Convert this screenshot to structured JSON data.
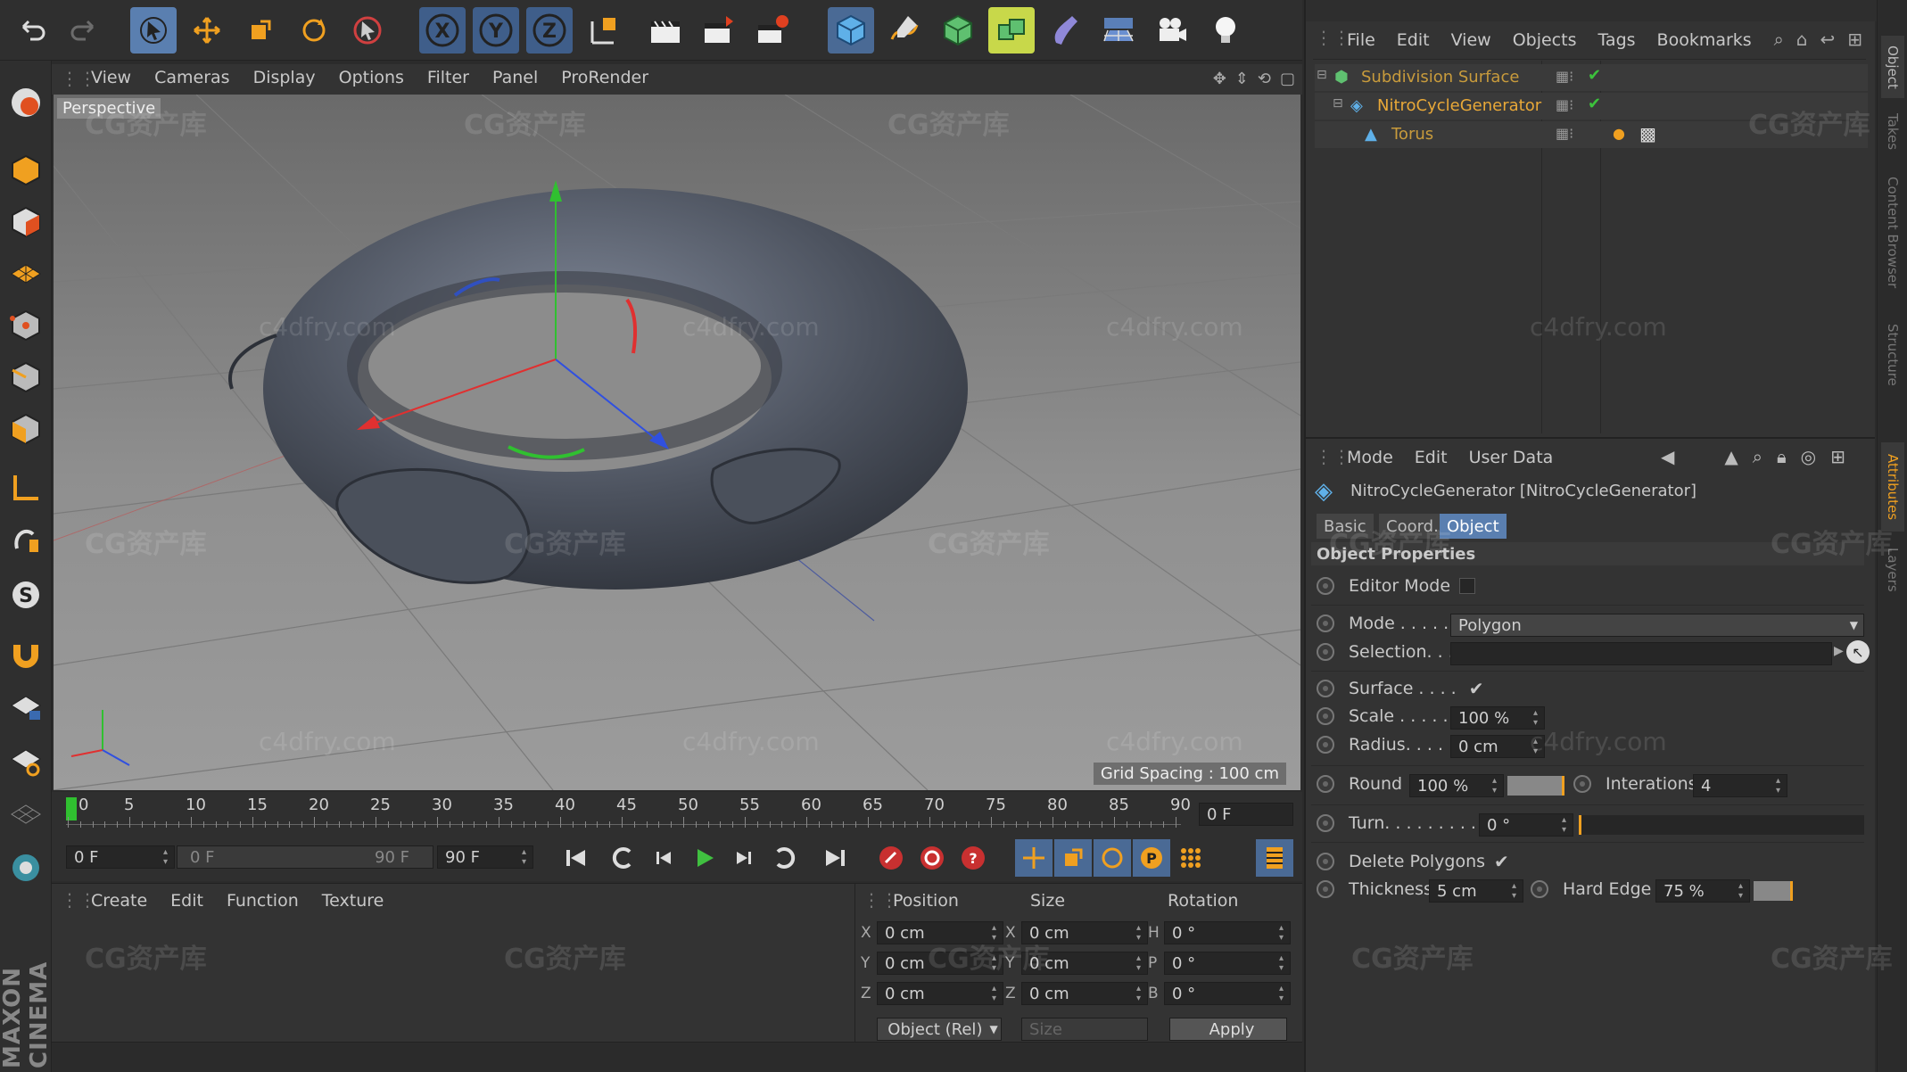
{
  "viewport": {
    "menu": [
      "View",
      "Cameras",
      "Display",
      "Options",
      "Filter",
      "Panel",
      "ProRender"
    ],
    "label": "Perspective",
    "grid_spacing": "Grid Spacing : 100 cm"
  },
  "objects_manager": {
    "menu": [
      "File",
      "Edit",
      "View",
      "Objects",
      "Tags",
      "Bookmarks"
    ],
    "tree": [
      {
        "name": "Subdivision Surface",
        "color": "#c89b3c"
      },
      {
        "name": "NitroCycleGenerator",
        "color": "#e8a838"
      },
      {
        "name": "Torus",
        "color": "#c89b3c"
      }
    ]
  },
  "side_tabs": [
    "Object",
    "Takes",
    "Content Browser",
    "Structure",
    "Attributes",
    "Layers"
  ],
  "attributes": {
    "menu": [
      "Mode",
      "Edit",
      "User Data"
    ],
    "title": "NitroCycleGenerator [NitroCycleGenerator]",
    "tabs": [
      "Basic",
      "Coord.",
      "Object"
    ],
    "section": "Object Properties",
    "editor_mode_label": "Editor Mode",
    "mode_label": "Mode . . . . .",
    "mode_value": "Polygon",
    "selection_label": "Selection. . .",
    "surface_label": "Surface . . . .",
    "scale_label": "Scale . . . . . .",
    "scale_value": "100 %",
    "radius_label": "Radius. . . . .",
    "radius_value": "0 cm",
    "round_label": "Round",
    "round_value": "100 %",
    "iterations_label": "Interations",
    "iterations_value": "4",
    "turn_label": "Turn. . . . . . . . . .",
    "turn_value": "0 °",
    "delete_polygons_label": "Delete Polygons",
    "thickness_label": "Thickness",
    "thickness_value": "5 cm",
    "hard_edge_label": "Hard Edge",
    "hard_edge_value": "75 %"
  },
  "timeline": {
    "ticks": [
      "0",
      "5",
      "10",
      "15",
      "20",
      "25",
      "30",
      "35",
      "40",
      "45",
      "50",
      "55",
      "60",
      "65",
      "70",
      "75",
      "80",
      "85",
      "90"
    ],
    "current_frame": "0 F",
    "start_field": "0 F",
    "range_start": "0 F",
    "range_end": "90 F",
    "end_field": "90 F"
  },
  "material_manager": {
    "menu": [
      "Create",
      "Edit",
      "Function",
      "Texture"
    ]
  },
  "coordinates": {
    "headers": [
      "Position",
      "Size",
      "Rotation"
    ],
    "rows": [
      {
        "pos_axis": "X",
        "pos": "0 cm",
        "size_axis": "X",
        "size": "0 cm",
        "rot_axis": "H",
        "rot": "0 °"
      },
      {
        "pos_axis": "Y",
        "pos": "0 cm",
        "size_axis": "Y",
        "size": "0 cm",
        "rot_axis": "P",
        "rot": "0 °"
      },
      {
        "pos_axis": "Z",
        "pos": "0 cm",
        "size_axis": "Z",
        "size": "0 cm",
        "rot_axis": "B",
        "rot": "0 °"
      }
    ],
    "mode_select": "Object (Rel)",
    "size_select": "Size",
    "apply_label": "Apply"
  },
  "branding": "MAXON CINEMA",
  "watermarks": [
    "CG资产库",
    "c4dfry.com"
  ],
  "colors": {
    "accent": "#5a7fb0",
    "object_orange": "#e8a838",
    "check_green": "#3cc23c"
  }
}
